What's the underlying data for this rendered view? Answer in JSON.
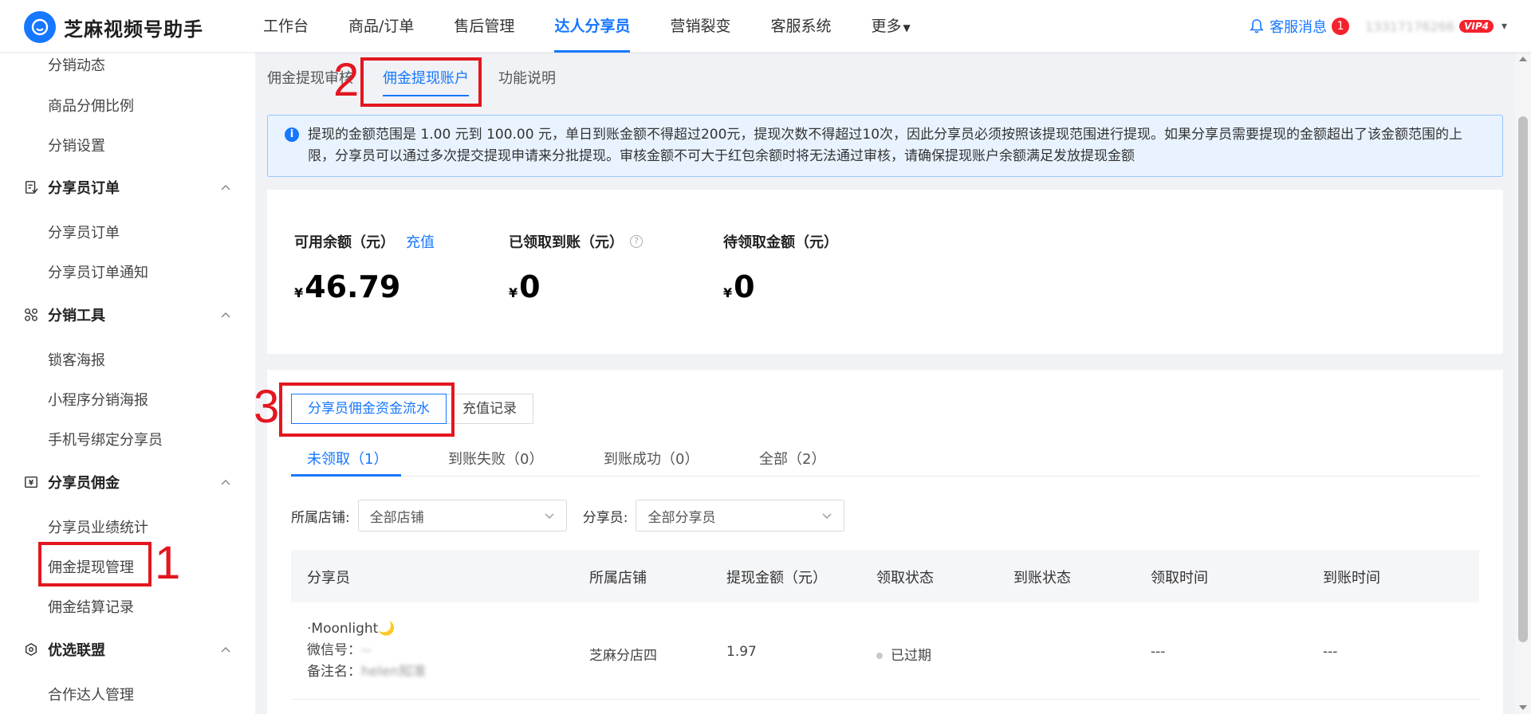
{
  "app": {
    "logo_text": "芝麻视频号助手",
    "nav": [
      "工作台",
      "商品/订单",
      "售后管理",
      "达人分享员",
      "营销裂变",
      "客服系统",
      "更多"
    ],
    "active_nav": "达人分享员",
    "service_label": "客服消息",
    "service_badge": "1",
    "account": "13317176266",
    "vip": "VIP4"
  },
  "sidebar": {
    "items_top": [
      "分销动态",
      "商品分佣比例",
      "分销设置"
    ],
    "group_orders": "分享员订单",
    "items_orders": [
      "分享员订单",
      "分享员订单通知"
    ],
    "group_tools": "分销工具",
    "items_tools": [
      "锁客海报",
      "小程序分销海报",
      "手机号绑定分享员"
    ],
    "group_commission": "分享员佣金",
    "items_commission": [
      "分享员业绩统计",
      "佣金提现管理",
      "佣金结算记录"
    ],
    "group_alliance": "优选联盟",
    "items_alliance": [
      "合作达人管理"
    ]
  },
  "tabs": [
    "佣金提现审核",
    "佣金提现账户",
    "功能说明"
  ],
  "alert_text": "提现的金额范围是 1.00 元到 100.00 元，单日到账金额不得超过200元，提现次数不得超过10次，因此分享员必须按照该提现范围进行提现。如果分享员需要提现的金额超出了该金额范围的上限，分享员可以通过多次提交提现申请来分批提现。审核金额不可大于红包余额时将无法通过审核，请确保提现账户余额满足发放提现金额",
  "stats": {
    "available_label": "可用余额（元）",
    "recharge_link": "充值",
    "available_value": "46.79",
    "received_label": "已领取到账（元）",
    "received_value": "0",
    "pending_label": "待领取金额（元）",
    "pending_value": "0",
    "currency": "¥"
  },
  "segment": [
    "分享员佣金资金流水",
    "充值记录"
  ],
  "subtabs": [
    "未领取（1）",
    "到账失败（0）",
    "到账成功（0）",
    "全部（2）"
  ],
  "filters": {
    "store_label": "所属店铺:",
    "store_value": "全部店铺",
    "sharer_label": "分享员:",
    "sharer_value": "全部分享员"
  },
  "table": {
    "headers": [
      "分享员",
      "所属店铺",
      "提现金额（元）",
      "领取状态",
      "到账状态",
      "领取时间",
      "到账时间"
    ],
    "rows": [
      {
        "nickname": "·Moonlight🌙",
        "wechat_label": "微信号：",
        "wechat_value": "--",
        "remark_label": "备注名：",
        "remark_value": "helen知准",
        "store": "芝麻分店四",
        "amount": "1.97",
        "claim_status": "已过期",
        "arrival_status": "",
        "claim_time": "---",
        "arrival_time": "---"
      }
    ]
  },
  "annotations": [
    "1",
    "2",
    "3"
  ],
  "colors": {
    "primary": "#1677ff",
    "annotation": "#e3161f"
  }
}
